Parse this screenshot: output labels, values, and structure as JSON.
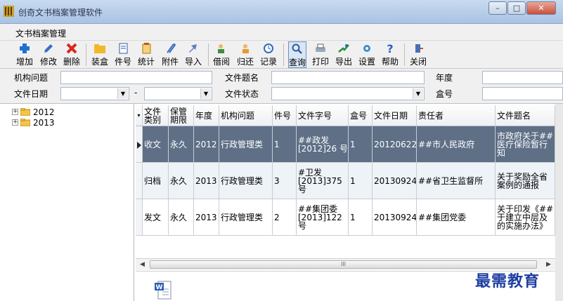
{
  "window": {
    "title": "创奇文书档案管理软件",
    "minimize": "–",
    "maximize": "□",
    "close": "✕"
  },
  "menu": {
    "label": "文书档案管理"
  },
  "toolbar": {
    "add": "增加",
    "edit": "修改",
    "delete": "删除",
    "box": "装盒",
    "item_no": "件号",
    "stats": "统计",
    "attach": "附件",
    "import": "导入",
    "borrow": "借阅",
    "return": "归还",
    "record": "记录",
    "query": "查询",
    "print": "打印",
    "export": "导出",
    "settings": "设置",
    "help": "帮助",
    "close": "关闭"
  },
  "filters": {
    "org_issue_label": "机构问题",
    "file_title_label": "文件题名",
    "year_label": "年度",
    "file_date_label": "文件日期",
    "file_status_label": "文件状态",
    "box_no_label": "盒号",
    "dash": "-"
  },
  "tree": {
    "items": [
      {
        "label": "2012"
      },
      {
        "label": "2013"
      }
    ]
  },
  "table": {
    "headers": [
      "文件类别",
      "保管期限",
      "年度",
      "机构问题",
      "件号",
      "文件字号",
      "盒号",
      "文件日期",
      "责任者",
      "文件题名"
    ],
    "rows": [
      [
        "收文",
        "永久",
        "2012",
        "行政管理类",
        "1",
        "##政发 [2012]26 号",
        "1",
        "20120622",
        "##市人民政府",
        "市政府关于## 医疗保险暂行 知"
      ],
      [
        "归档",
        "永久",
        "2013",
        "行政管理类",
        "3",
        "#卫发 [2013]375 号",
        "1",
        "20130924",
        "##省卫生监督所",
        "关于奖励全省 案例的通报"
      ],
      [
        "发文",
        "永久",
        "2013",
        "行政管理类",
        "2",
        "##集团委 [2013]122 号",
        "1",
        "20130924",
        "##集团党委",
        "关于印发《## 于建立中层及 的实施办法》"
      ]
    ]
  },
  "scroll": {
    "thumb_grip": "III"
  },
  "watermark": "最需教育",
  "colors": {
    "selected_row": "#5e6f86",
    "title_bar": "#b7cde8",
    "watermark": "#1e3fa0"
  }
}
